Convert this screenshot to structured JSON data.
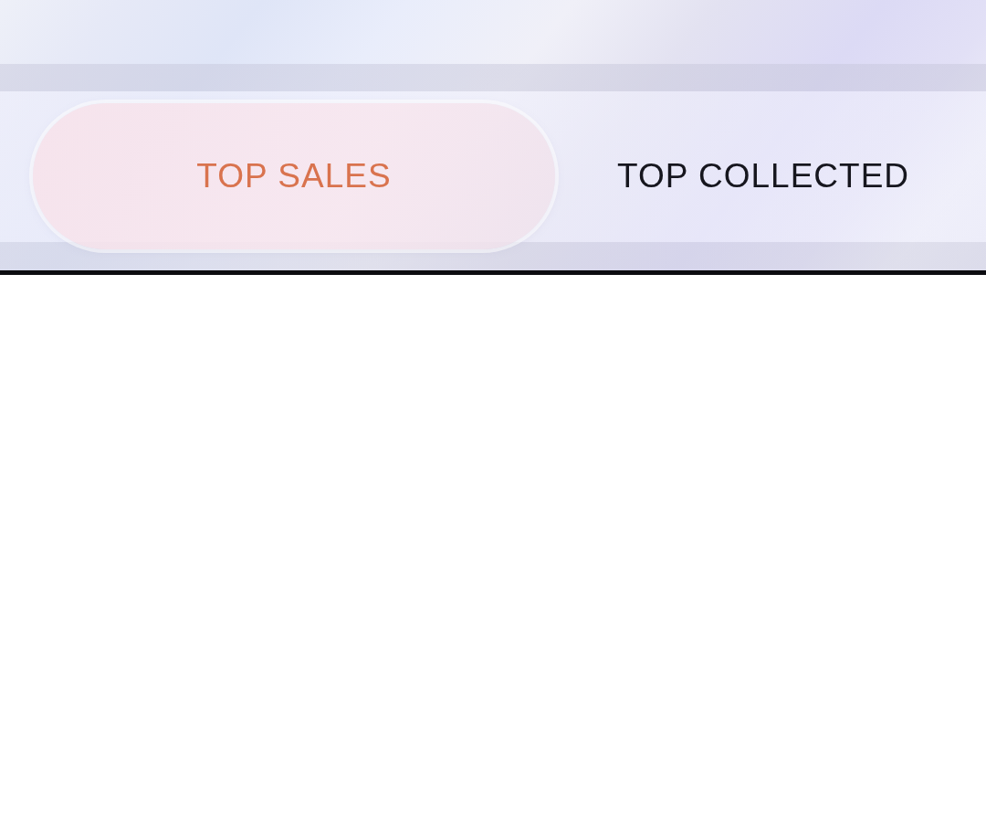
{
  "tabs": [
    {
      "label": "TOP SALES",
      "selected": true
    },
    {
      "label": "TOP COLLECTED",
      "selected": false
    }
  ]
}
